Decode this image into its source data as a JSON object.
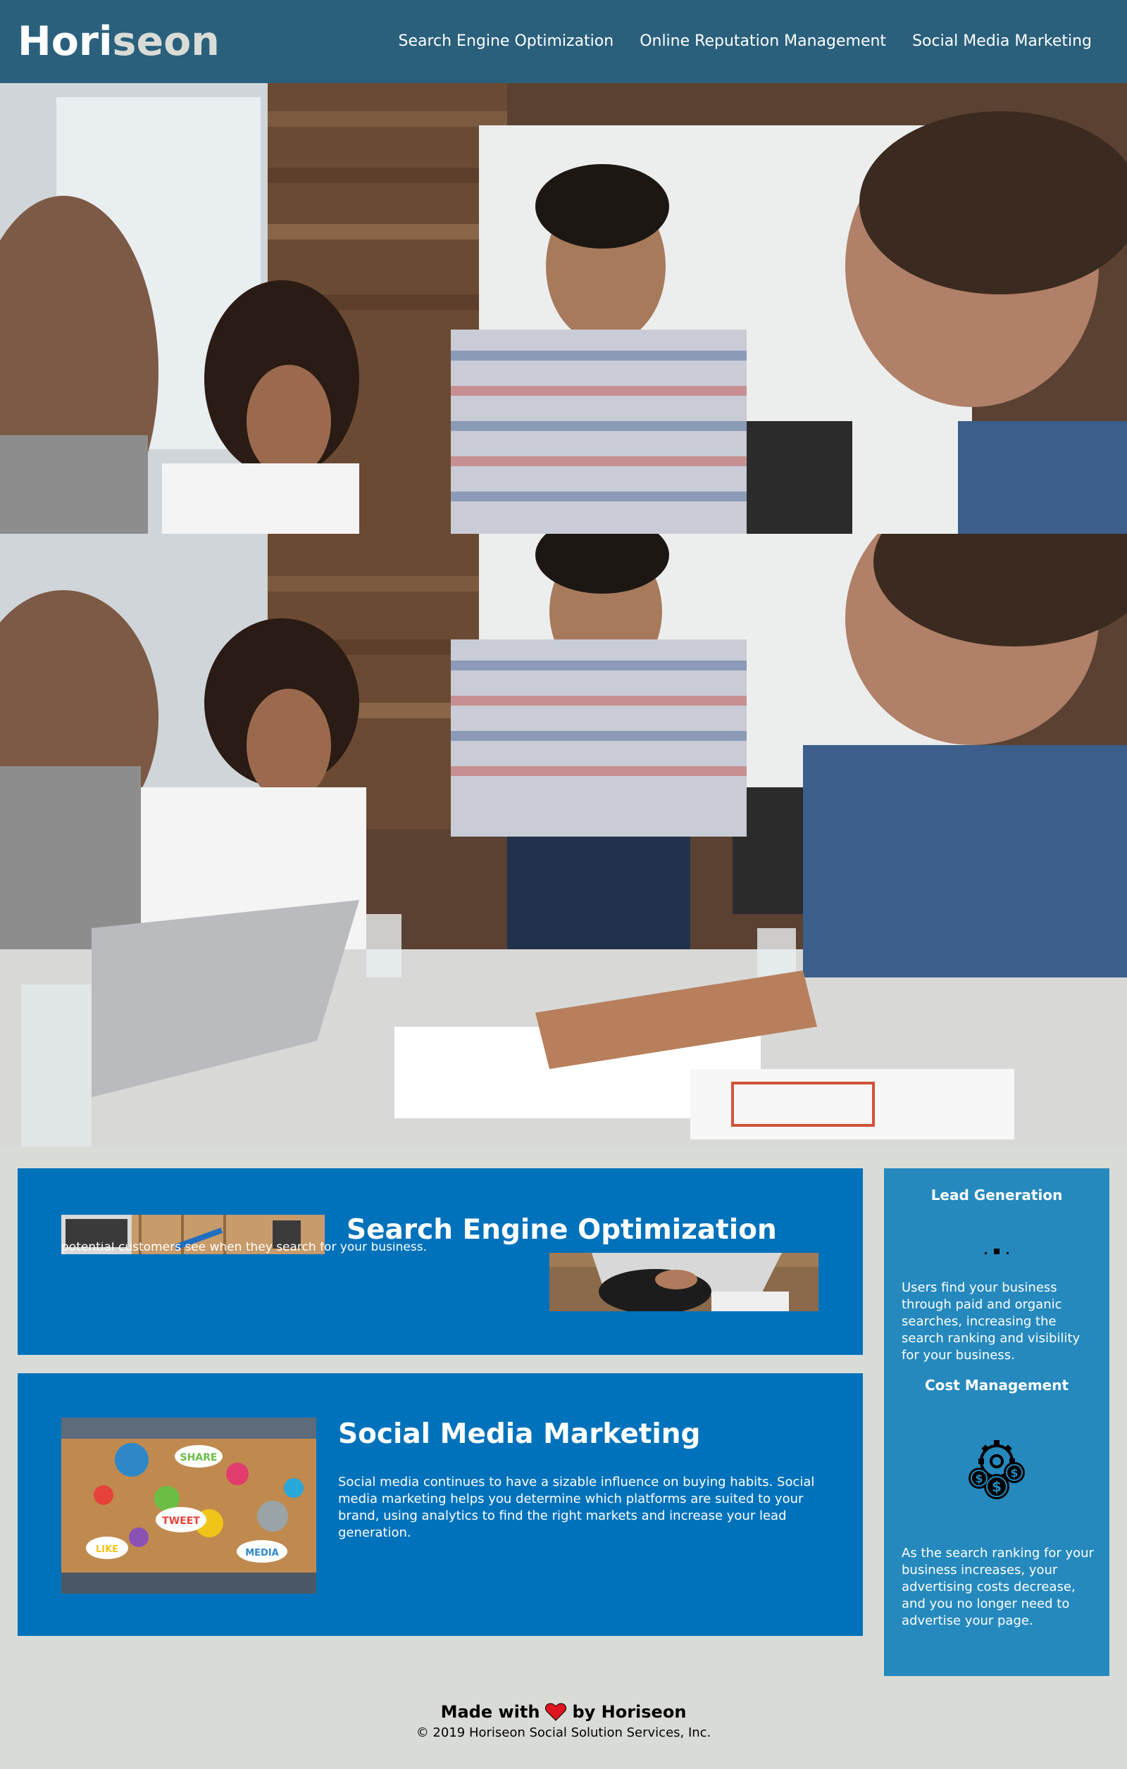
{
  "header": {
    "logo_main": "Hori",
    "logo_accent": "seon",
    "nav": [
      {
        "label": "Search Engine Optimization"
      },
      {
        "label": "Online Reputation Management"
      },
      {
        "label": "Social Media Marketing"
      }
    ]
  },
  "seo": {
    "title": "Search Engine Optimization",
    "text_fragment": "potential customers see when they search for your business."
  },
  "smm": {
    "title": "Social Media Marketing",
    "text": "Social media continues to have a sizable influence on buying habits. Social media marketing helps you determine which platforms are suited to your brand, using analytics to find the right markets and increase your lead generation.",
    "image_words": [
      "SHARE",
      "TWEET",
      "LIKE",
      "MEDIA"
    ]
  },
  "benefits": {
    "lead": {
      "title": "Lead Generation",
      "text": "Users find your business through paid and organic searches, increasing the search ranking and visibility for your business."
    },
    "cost": {
      "title": "Cost Management",
      "text": "As the search ranking for your business increases, your advertising costs decrease, and you no longer need to advertise your page."
    }
  },
  "footer": {
    "made_prefix": "Made with",
    "made_suffix": "by Horiseon",
    "copyright": "© 2019 Horiseon Social Solution Services, Inc."
  },
  "colors": {
    "header_bg": "#2a607c",
    "page_bg": "#d9dcd6",
    "card_bg": "#0072bb",
    "aside_bg": "#2589bd",
    "heart": "#e0141e"
  }
}
